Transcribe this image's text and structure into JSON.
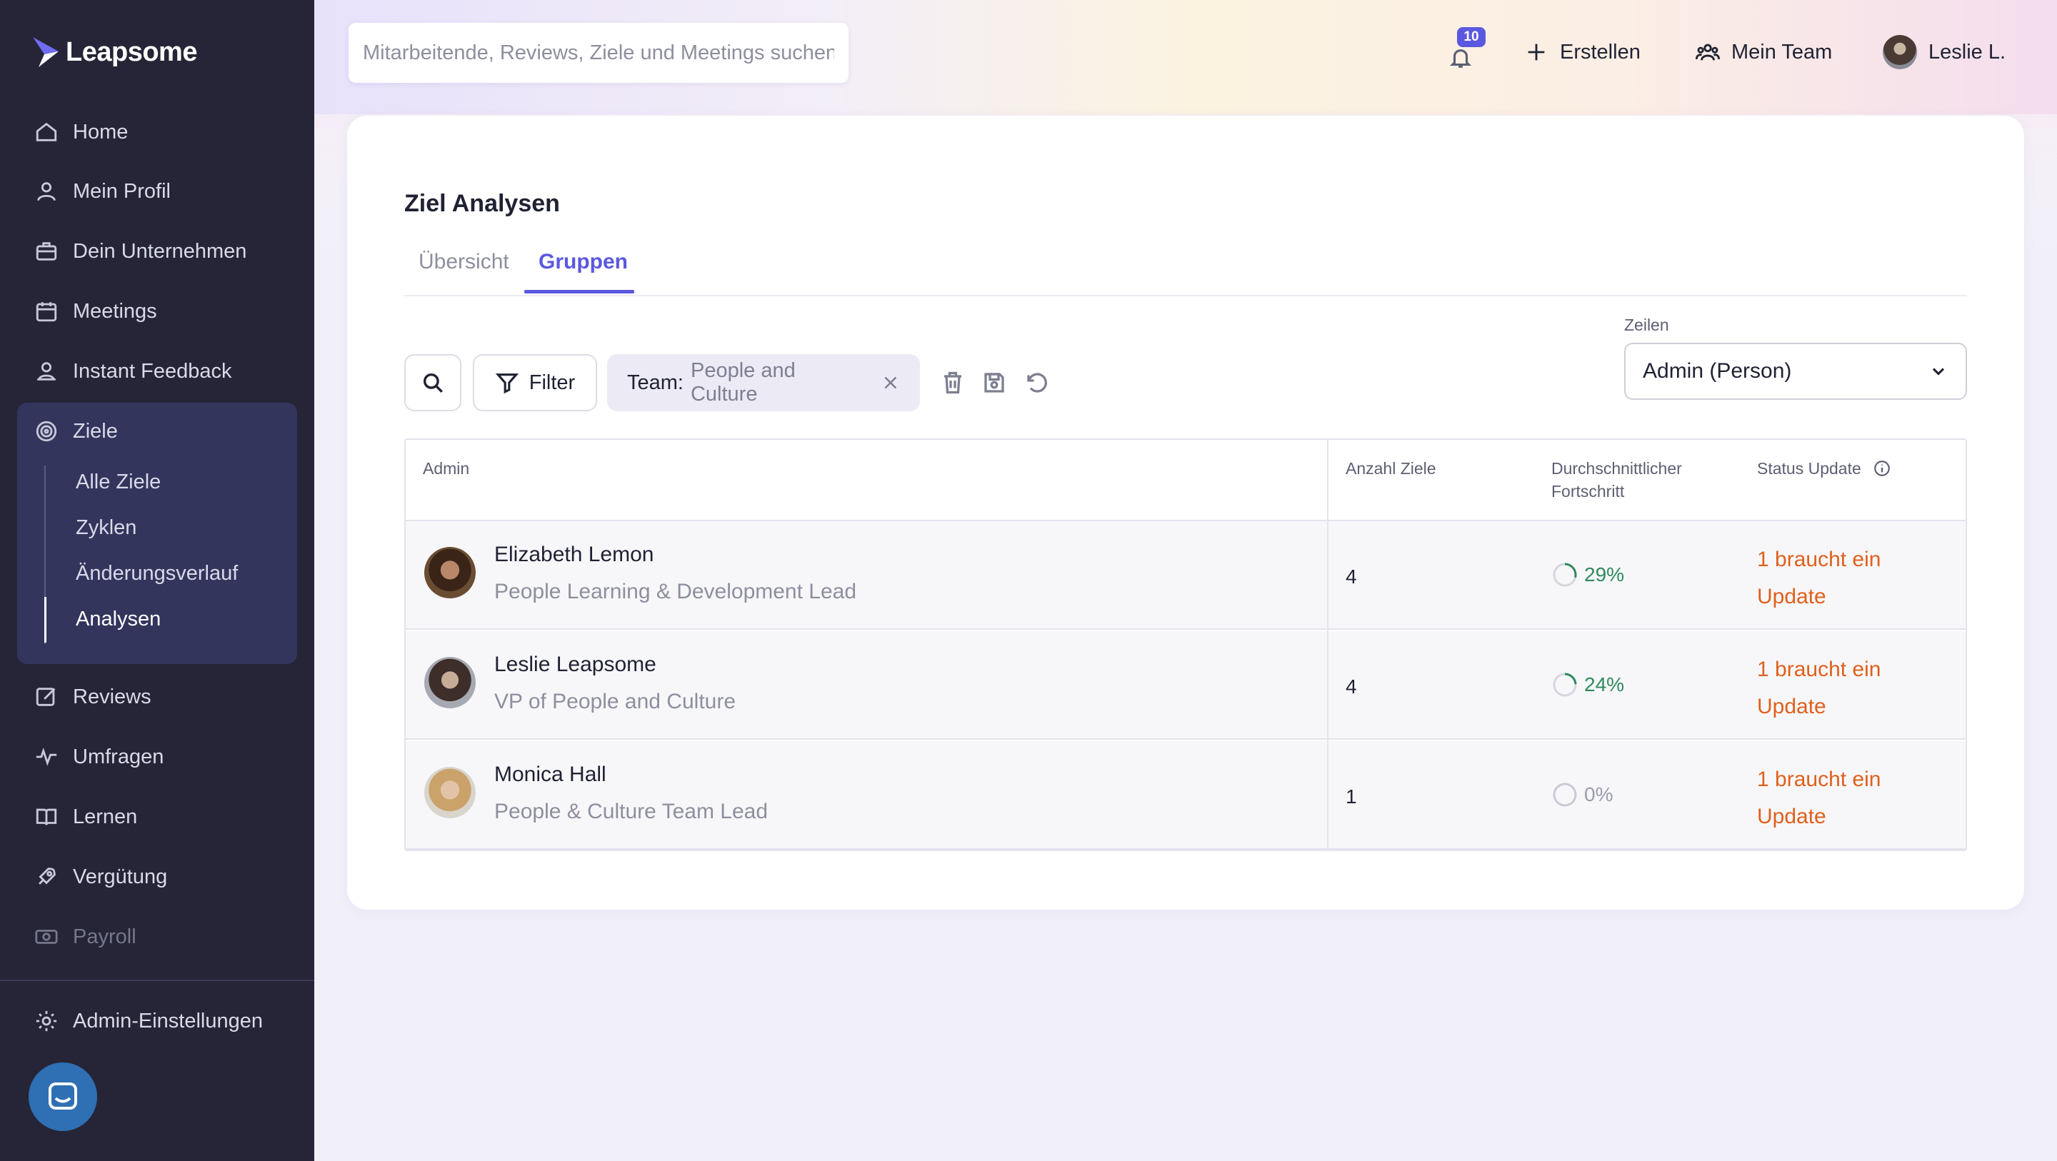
{
  "brand": {
    "name": "Leapsome"
  },
  "sidebar": {
    "items": [
      {
        "label": "Home",
        "icon": "home-icon"
      },
      {
        "label": "Mein Profil",
        "icon": "user-icon"
      },
      {
        "label": "Dein Unternehmen",
        "icon": "briefcase-icon"
      },
      {
        "label": "Meetings",
        "icon": "calendar-icon"
      },
      {
        "label": "Instant Feedback",
        "icon": "feedback-icon"
      },
      {
        "label": "Ziele",
        "icon": "target-icon"
      },
      {
        "label": "Reviews",
        "icon": "edit-icon"
      },
      {
        "label": "Umfragen",
        "icon": "pulse-icon"
      },
      {
        "label": "Lernen",
        "icon": "book-icon"
      },
      {
        "label": "Vergütung",
        "icon": "rocket-icon"
      },
      {
        "label": "Payroll",
        "icon": "money-icon"
      },
      {
        "label": "Admin-Einstellungen",
        "icon": "gear-icon"
      }
    ],
    "ziele_sub": [
      "Alle Ziele",
      "Zyklen",
      "Änderungsverlauf",
      "Analysen"
    ],
    "active_sub": "Analysen"
  },
  "topbar": {
    "search_placeholder": "Mitarbeitende, Reviews, Ziele und Meetings suchen",
    "notifications": "10",
    "create_label": "Erstellen",
    "team_label": "Mein Team",
    "user_label": "Leslie L."
  },
  "page": {
    "title": "Ziel Analysen",
    "tabs": [
      "Übersicht",
      "Gruppen"
    ],
    "active_tab": "Gruppen"
  },
  "toolbar": {
    "filter_label": "Filter",
    "chip_key": "Team:",
    "chip_value": "People and Culture",
    "rows_label": "Zeilen",
    "rows_value": "Admin (Person)"
  },
  "table": {
    "headers": {
      "admin": "Admin",
      "count": "Anzahl Ziele",
      "progress_1": "Durchschnittlicher",
      "progress_2": "Fortschritt",
      "status": "Status Update"
    },
    "rows": [
      {
        "name": "Elizabeth Lemon",
        "role": "People Learning & Development Lead",
        "count": "4",
        "progress": "29%",
        "progress_value": 0.29,
        "status_1": "1 braucht ein",
        "status_2": "Update"
      },
      {
        "name": "Leslie Leapsome",
        "role": "VP of People and Culture",
        "count": "4",
        "progress": "24%",
        "progress_value": 0.24,
        "status_1": "1 braucht ein",
        "status_2": "Update"
      },
      {
        "name": "Monica Hall",
        "role": "People & Culture Team Lead",
        "count": "1",
        "progress": "0%",
        "progress_value": 0,
        "status_1": "1 braucht ein",
        "status_2": "Update"
      }
    ]
  },
  "colors": {
    "sidebar_bg": "#252537",
    "accent": "#5b58e0",
    "progress_green": "#2f8a5b",
    "status_orange": "#e0601c"
  }
}
